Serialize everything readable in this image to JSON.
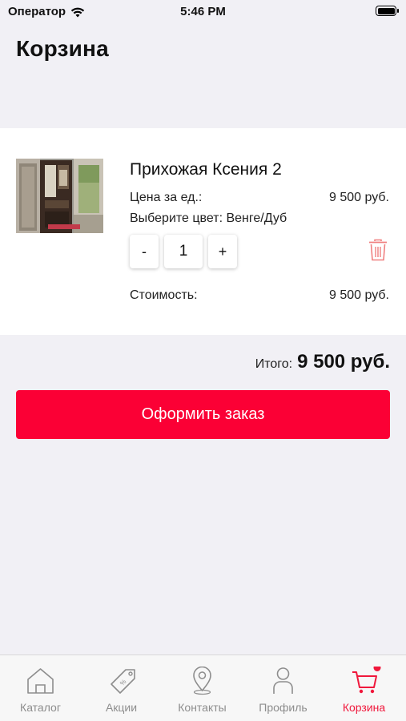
{
  "status_bar": {
    "carrier": "Оператор",
    "time": "5:46 PM"
  },
  "header": {
    "title": "Корзина"
  },
  "cart": {
    "item": {
      "name": "Прихожая Ксения 2",
      "price_label": "Цена за ед.:",
      "price_value": "9 500 руб.",
      "color_line": "Выберите цвет: Венге/Дуб",
      "qty_minus": "-",
      "quantity": "1",
      "qty_plus": "+",
      "cost_label": "Стоимость:",
      "cost_value": "9 500 руб."
    },
    "total_label": "Итого:",
    "total_value": "9 500 руб.",
    "order_button": "Оформить заказ"
  },
  "tabbar": {
    "items": [
      {
        "label": "Каталог",
        "icon": "home-icon"
      },
      {
        "label": "Акции",
        "icon": "tag-icon"
      },
      {
        "label": "Контакты",
        "icon": "location-pin-icon"
      },
      {
        "label": "Профиль",
        "icon": "person-icon"
      },
      {
        "label": "Корзина",
        "icon": "cart-icon",
        "active": true
      }
    ]
  },
  "colors": {
    "accent": "#fb0035",
    "active_tab": "#f0183c",
    "inactive_tab": "#8d8d8d",
    "background": "#f1f0f5"
  }
}
